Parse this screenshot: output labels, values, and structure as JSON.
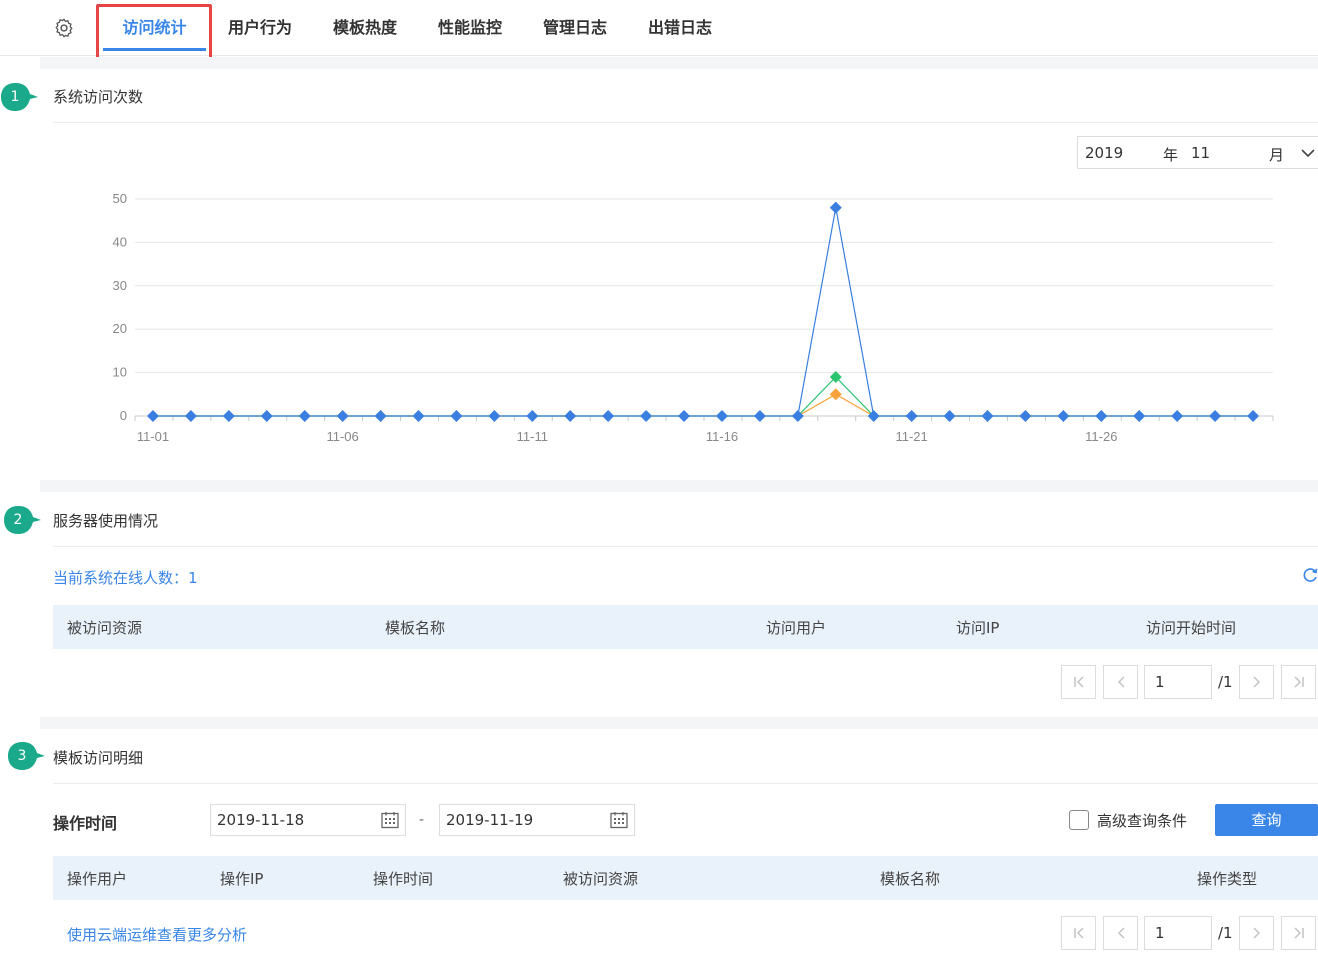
{
  "nav": {
    "tabs": [
      {
        "label": "访问统计",
        "active": true
      },
      {
        "label": "用户行为"
      },
      {
        "label": "模板热度"
      },
      {
        "label": "性能监控"
      },
      {
        "label": "管理日志"
      },
      {
        "label": "出错日志"
      }
    ]
  },
  "section1": {
    "badge": "1",
    "title": "系统访问次数",
    "year_select": {
      "year": "2019",
      "year_unit": "年",
      "month": "11",
      "month_unit": "月"
    }
  },
  "chart_data": {
    "type": "line",
    "x": [
      "11-01",
      "11-02",
      "11-03",
      "11-04",
      "11-05",
      "11-06",
      "11-07",
      "11-08",
      "11-09",
      "11-10",
      "11-11",
      "11-12",
      "11-13",
      "11-14",
      "11-15",
      "11-16",
      "11-17",
      "11-18",
      "11-19",
      "11-20",
      "11-21",
      "11-22",
      "11-23",
      "11-24",
      "11-25",
      "11-26",
      "11-27",
      "11-28",
      "11-29",
      "11-30"
    ],
    "x_tick_labels": [
      "11-01",
      "11-06",
      "11-11",
      "11-16",
      "11-21",
      "11-26"
    ],
    "ylim": [
      0,
      50
    ],
    "y_ticks": [
      0,
      10,
      20,
      30,
      40,
      50
    ],
    "grid": true,
    "series": [
      {
        "color": "#3a7fe0",
        "values": [
          0,
          0,
          0,
          0,
          0,
          0,
          0,
          0,
          0,
          0,
          0,
          0,
          0,
          0,
          0,
          0,
          0,
          0,
          48,
          0,
          0,
          0,
          0,
          0,
          0,
          0,
          0,
          0,
          0,
          0
        ]
      },
      {
        "color": "#2cc56f",
        "values": [
          0,
          0,
          0,
          0,
          0,
          0,
          0,
          0,
          0,
          0,
          0,
          0,
          0,
          0,
          0,
          0,
          0,
          0,
          9,
          0,
          0,
          0,
          0,
          0,
          0,
          0,
          0,
          0,
          0,
          0
        ]
      },
      {
        "color": "#f5a33a",
        "values": [
          0,
          0,
          0,
          0,
          0,
          0,
          0,
          0,
          0,
          0,
          0,
          0,
          0,
          0,
          0,
          0,
          0,
          0,
          5,
          0,
          0,
          0,
          0,
          0,
          0,
          0,
          0,
          0,
          0,
          0
        ]
      }
    ]
  },
  "section2": {
    "badge": "2",
    "title": "服务器使用情况",
    "online_text": "当前系统在线人数：1",
    "table_headers": [
      "被访问资源",
      "模板名称",
      "访问用户",
      "访问IP",
      "访问开始时间"
    ],
    "pager": {
      "page": "1",
      "total": "/1"
    }
  },
  "section3": {
    "badge": "3",
    "title": "模板访问明细",
    "time_label": "操作时间",
    "start_date": "2019-11-18",
    "separator": "-",
    "end_date": "2019-11-19",
    "advanced_label": "高级查询条件",
    "query_button": "查询",
    "table_headers": [
      "操作用户",
      "操作IP",
      "操作时间",
      "被访问资源",
      "模板名称",
      "操作类型"
    ],
    "link_text": "使用云端运维查看更多分析",
    "pager": {
      "page": "1",
      "total": "/1"
    }
  }
}
